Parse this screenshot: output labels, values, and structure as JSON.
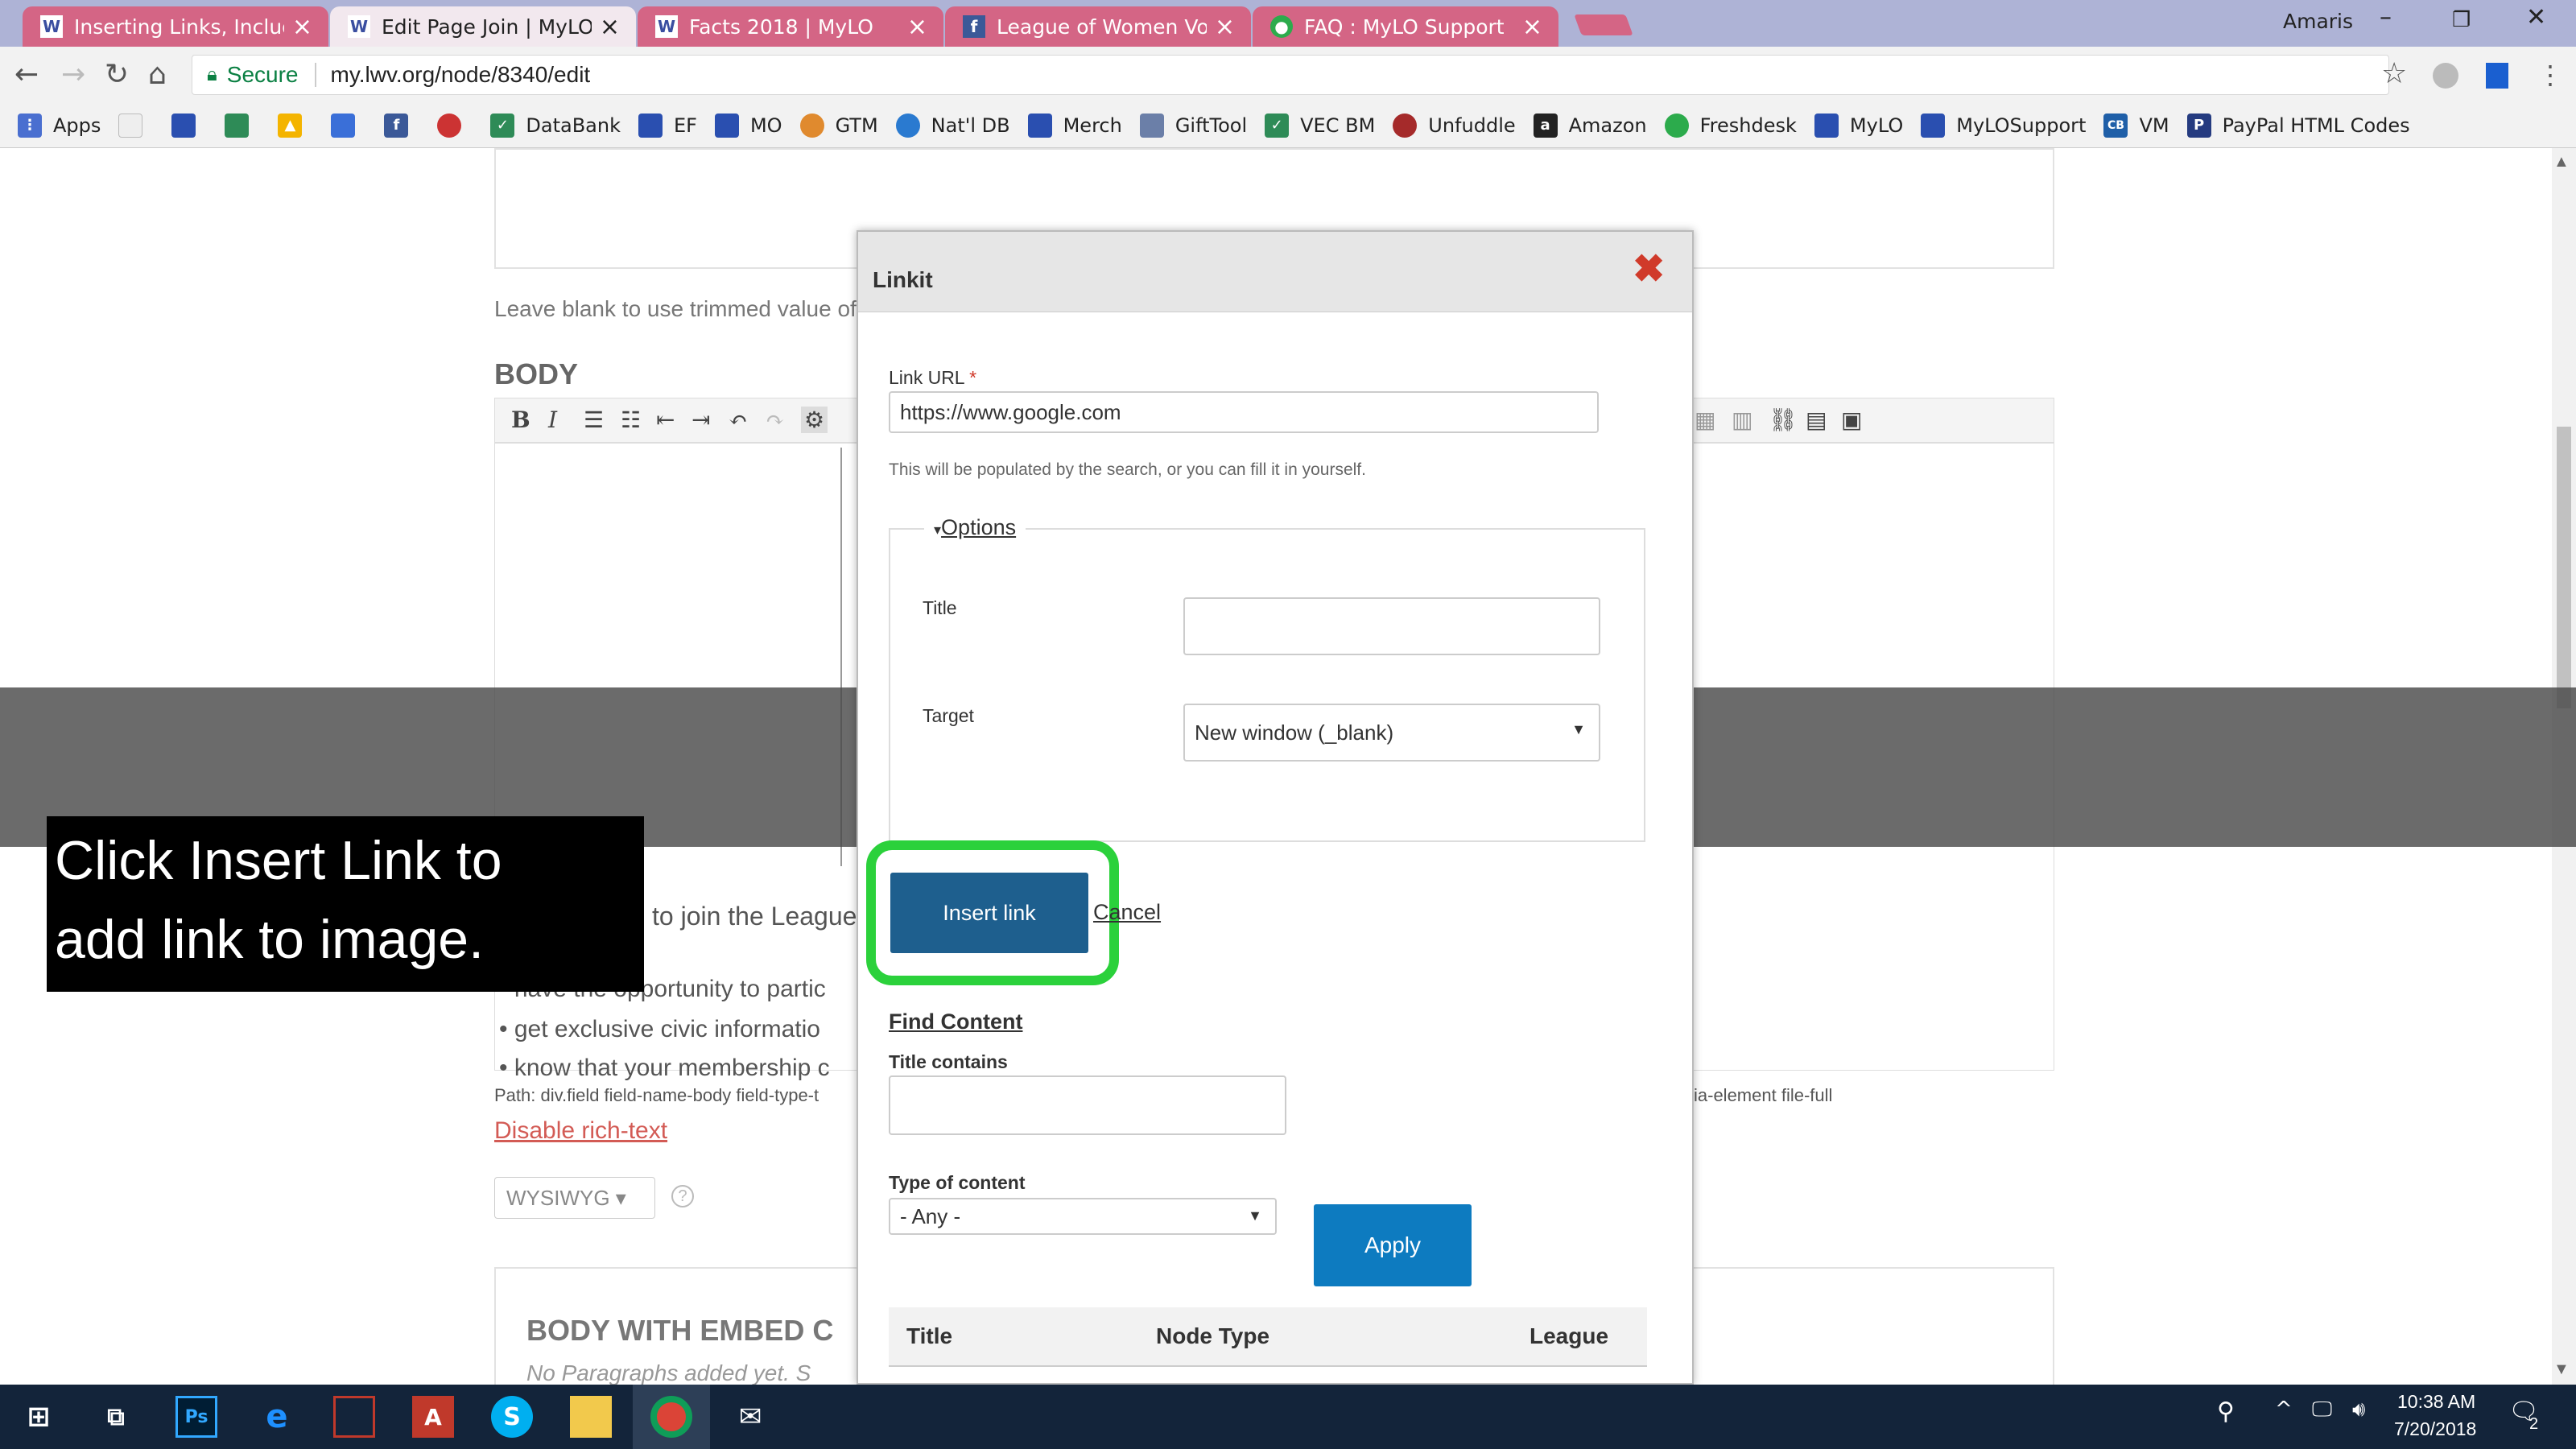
{
  "browser": {
    "tabs": [
      {
        "title": "Inserting Links, Including",
        "icon": "LWV"
      },
      {
        "title": "Edit Page Join | MyLO",
        "icon": "LWV"
      },
      {
        "title": "Facts 2018 | MyLO",
        "icon": "LWV"
      },
      {
        "title": "League of Women Voters",
        "icon": "f"
      },
      {
        "title": "FAQ : MyLO Support",
        "icon": "MyLO"
      }
    ],
    "profile": "Amaris",
    "secure_label": "Secure",
    "url": "my.lwv.org/node/8340/edit",
    "bookmarks": [
      {
        "label": "Apps",
        "color": "#4a6fd0"
      },
      {
        "label": "",
        "color": "#dddddd"
      },
      {
        "label": "",
        "color": "#2a4fb0"
      },
      {
        "label": "",
        "color": "#2e8b57"
      },
      {
        "label": "",
        "color": "#f4b400"
      },
      {
        "label": "",
        "color": "#3a6fd8"
      },
      {
        "label": "",
        "color": "#3b5998"
      },
      {
        "label": "",
        "color": "#cc3333"
      },
      {
        "label": "DataBank",
        "color": "#2e8b57"
      },
      {
        "label": "EF",
        "color": "#2a4fb0"
      },
      {
        "label": "MO",
        "color": "#2a4fb0"
      },
      {
        "label": "GTM",
        "color": "#e08a2e"
      },
      {
        "label": "Nat'l DB",
        "color": "#2a7ad0"
      },
      {
        "label": "Merch",
        "color": "#2a4fb0"
      },
      {
        "label": "GiftTool",
        "color": "#6b7fa8"
      },
      {
        "label": "VEC BM",
        "color": "#2e8b57"
      },
      {
        "label": "Unfuddle",
        "color": "#a52a2a"
      },
      {
        "label": "Amazon",
        "color": "#222222"
      },
      {
        "label": "Freshdesk",
        "color": "#2cab4c"
      },
      {
        "label": "MyLO",
        "color": "#2a4fb0"
      },
      {
        "label": "MyLOSupport",
        "color": "#2a4fb0"
      },
      {
        "label": "VM",
        "color": "#1f5fa8"
      },
      {
        "label": "PayPal HTML Codes",
        "color": "#253b80"
      }
    ],
    "bookmark_cb": "CB"
  },
  "page": {
    "leave_blank": "Leave blank to use trimmed value of f",
    "body_label": "BODY",
    "join_text": "to join the League",
    "bullets": [
      "have the opportunity to partic",
      "get exclusive civic informatio",
      "know that your membership c"
    ],
    "path_text": "Path: div.field field-name-body field-type-t",
    "path_right": "ia-element file-full",
    "disable_rich_text": "Disable rich-text",
    "format_select": "WYSIWYG",
    "help": "?",
    "embed_label": "BODY WITH EMBED C",
    "no_paragraphs": "No Paragraphs added yet. S"
  },
  "modal": {
    "title": "Linkit",
    "link_url_label": "Link URL",
    "required_mark": "*",
    "link_url_value": "https://www.google.com",
    "link_url_help": "This will be populated by the search, or you can fill it in yourself.",
    "options_legend": "Options",
    "title_label": "Title",
    "title_value": "",
    "target_label": "Target",
    "target_value": "New window (_blank)",
    "insert_button": "Insert link",
    "cancel_link": "Cancel",
    "find_content": "Find Content",
    "title_contains_label": "Title contains",
    "title_contains_value": "",
    "type_label": "Type of content",
    "type_value": "- Any -",
    "apply_button": "Apply",
    "results_columns": [
      "Title",
      "Node Type",
      "League"
    ]
  },
  "caption": {
    "line1": "Click Insert Link to",
    "line2": "add link to image."
  },
  "taskbar": {
    "time": "10:38 AM",
    "date": "7/20/2018",
    "notifications": "2"
  },
  "colors": {
    "highlight": "#2bd13b",
    "insert_button": "#1e5f8e",
    "apply_button": "#0d7bc0",
    "close_x": "#d03a2a"
  }
}
